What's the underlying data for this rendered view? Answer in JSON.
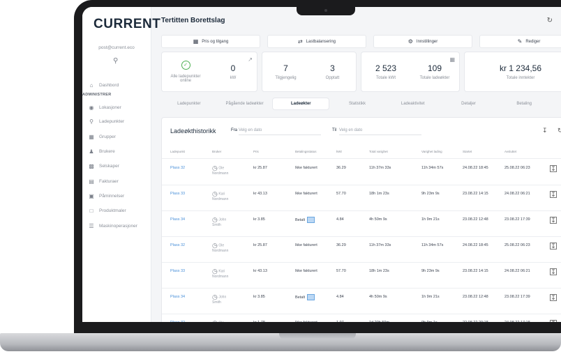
{
  "sidebar": {
    "logo": "CURRENT",
    "email": "post@current.eco",
    "items_top": [
      {
        "label": "Dashbord",
        "icon": "home-icon"
      }
    ],
    "section": "ADMINISTRER",
    "items": [
      {
        "label": "Lokasjoner",
        "icon": "location-icon"
      },
      {
        "label": "Ladepunkter",
        "icon": "charger-icon"
      },
      {
        "label": "Grupper",
        "icon": "group-icon"
      },
      {
        "label": "Brukere",
        "icon": "users-icon"
      },
      {
        "label": "Selskaper",
        "icon": "building-icon"
      },
      {
        "label": "Fakturaer",
        "icon": "invoice-icon"
      },
      {
        "label": "Påminnelser",
        "icon": "reminder-icon"
      },
      {
        "label": "Produktmaler",
        "icon": "product-icon"
      },
      {
        "label": "Maskinoperasjoner",
        "icon": "operations-icon"
      }
    ]
  },
  "header": {
    "title": "Tertitten Borettslag"
  },
  "actions": [
    {
      "label": "Pris og tilgang",
      "icon": "price-icon"
    },
    {
      "label": "Lastbalansering",
      "icon": "balance-icon"
    },
    {
      "label": "Innstillinger",
      "icon": "settings-icon"
    },
    {
      "label": "Rediger",
      "icon": "edit-icon"
    }
  ],
  "stats": {
    "online": "Alle ladepunkter online",
    "kw_value": "0",
    "kw_label": "kW",
    "available_value": "7",
    "available_label": "Tilgjengelig",
    "occupied_value": "3",
    "occupied_label": "Opptatt",
    "kwh_value": "2 523",
    "kwh_label": "Totale kWt",
    "sessions_value": "109",
    "sessions_label": "Totale ladeøkter",
    "income_value": "kr 1 234,56",
    "income_label": "Totale inntekter"
  },
  "tabs": [
    "Ladepunkter",
    "Pågående ladeøkter",
    "Ladeøkter",
    "Statistikk",
    "Ladeaktivitet",
    "Detaljer",
    "Betaling"
  ],
  "history": {
    "title": "Ladeøkthistorikk",
    "from_label": "Fra",
    "from_placeholder": "Velg en dato",
    "to_label": "Til",
    "to_placeholder": "Velg en dato"
  },
  "table": {
    "headers": [
      "Ladepunkt",
      "Bruker",
      "Pris",
      "Betalingsstatus",
      "kWt",
      "Total varighet",
      "Varighet lading",
      "Startet",
      "Avsluttet"
    ],
    "rows": [
      {
        "point": "Plass 32",
        "user_a": "Ole",
        "user_b": "Nordmann",
        "price": "kr 25.87",
        "status": "Ikke fakturert",
        "kwh": "36.29",
        "total": "11h 37m 33s",
        "charge": "11h 34m 57s",
        "start": "24.08.22 18:45",
        "end": "25.08.22 06:23",
        "invoice": false
      },
      {
        "point": "Plass 33",
        "user_a": "Kari",
        "user_b": "Nordmann",
        "price": "kr 43.13",
        "status": "Ikke fakturert",
        "kwh": "57.70",
        "total": "18h 1m 23s",
        "charge": "9h 23m 9s",
        "start": "23.08.22 14:15",
        "end": "24.08.22 06:21",
        "invoice": false
      },
      {
        "point": "Plass 34",
        "user_a": "John",
        "user_b": "Smith",
        "price": "kr 3.85",
        "status": "Betalt",
        "kwh": "4.84",
        "total": "4h 50m 9s",
        "charge": "1h 9m 21s",
        "start": "23.08.22 12:48",
        "end": "23.08.22 17:39",
        "invoice": true
      },
      {
        "point": "Plass 32",
        "user_a": "Ole",
        "user_b": "Nordmann",
        "price": "kr 25.87",
        "status": "Ikke fakturert",
        "kwh": "36.29",
        "total": "11h 37m 33s",
        "charge": "11h 34m 57s",
        "start": "24.08.22 18:45",
        "end": "25.08.22 06:23",
        "invoice": false
      },
      {
        "point": "Plass 33",
        "user_a": "Kari",
        "user_b": "Nordmann",
        "price": "kr 43.13",
        "status": "Ikke fakturert",
        "kwh": "57.70",
        "total": "18h 1m 23s",
        "charge": "9h 23m 9s",
        "start": "23.08.22 14:15",
        "end": "24.08.22 06:21",
        "invoice": false
      },
      {
        "point": "Plass 34",
        "user_a": "John",
        "user_b": "Smith",
        "price": "kr 3.85",
        "status": "Betalt",
        "kwh": "4.84",
        "total": "4h 50m 9s",
        "charge": "1h 9m 21s",
        "start": "23.08.22 12:48",
        "end": "23.08.22 17:39",
        "invoice": true
      },
      {
        "point": "Plass 32",
        "user_a": "Ole",
        "user_b": "Nordmann",
        "price": "kr 1.78",
        "status": "Ikke fakturert",
        "kwh": "1.97",
        "total": "1d 20h 59m",
        "charge": "9h 9m 1s",
        "start": "22.08.22 20:18",
        "end": "24.08.22 17:18",
        "invoice": false
      }
    ]
  }
}
